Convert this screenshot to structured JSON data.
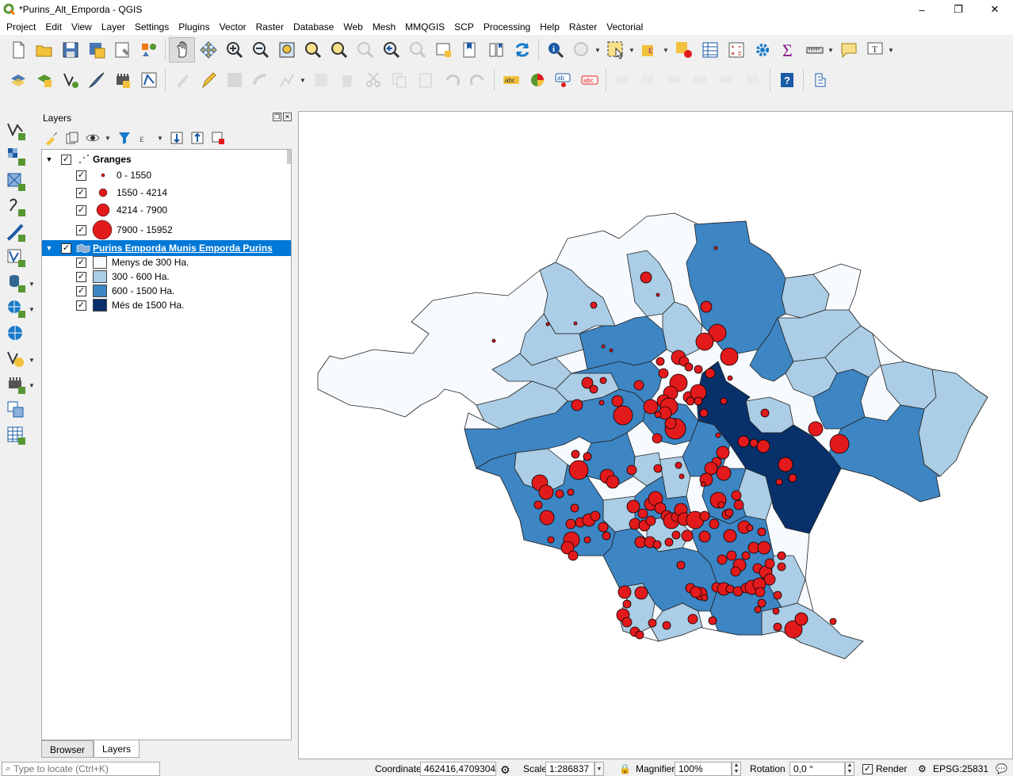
{
  "window": {
    "title": "*Purins_Alt_Emporda - QGIS",
    "minimize": "–",
    "restore": "❐",
    "close": "✕"
  },
  "menu": [
    "Project",
    "Edit",
    "View",
    "Layer",
    "Settings",
    "Plugins",
    "Vector",
    "Raster",
    "Database",
    "Web",
    "Mesh",
    "MMQGIS",
    "SCP",
    "Processing",
    "Help",
    "Ràster",
    "Vectorial"
  ],
  "toolbar1": [
    "new-project-icon",
    "open-project-icon",
    "save-project-icon",
    "save-as-icon",
    "print-layout-icon",
    "style-manager-icon",
    "pan-icon",
    "pan-to-selection-icon",
    "zoom-in-icon",
    "zoom-out-icon",
    "zoom-full-icon",
    "zoom-to-selection-icon",
    "zoom-to-layer-icon",
    "zoom-native-icon",
    "zoom-last-icon",
    "zoom-next-icon",
    "new-map-view-icon",
    "new-bookmark-icon",
    "show-bookmarks-icon",
    "refresh-icon",
    "identify-icon",
    "run-action-icon",
    "select-features-icon",
    "select-by-expression-icon",
    "deselect-icon",
    "attribute-table-icon",
    "field-calculator-icon",
    "toolbox-icon",
    "statistics-icon",
    "measure-icon",
    "map-tips-icon",
    "text-annotation-icon"
  ],
  "toolbar2": [
    "layer-style-icon",
    "data-source-icon",
    "digitize-icon",
    "digitize-pen-icon",
    "gps-icon",
    "vertex-tool-icon",
    "current-edits-icon",
    "toggle-editing-icon",
    "save-edits-icon",
    "add-feature-icon",
    "move-feature-icon",
    "node-tool-icon",
    "delete-selected-icon",
    "cut-icon",
    "copy-icon",
    "paste-icon",
    "undo-icon",
    "redo-icon",
    "label-icon",
    "diagram-icon",
    "pin-label-icon",
    "show-hide-label-icon",
    "move-label-icon",
    "rotate-label-icon",
    "change-label-icon",
    "label-tool-1-icon",
    "label-tool-2-icon",
    "label-tool-3-icon",
    "help-icon",
    "plugin-icon"
  ],
  "layers_panel": {
    "title": "Layers",
    "groups": [
      {
        "name": "Granges",
        "checked": true,
        "expanded": true,
        "classes": [
          {
            "label": "0 - 1550",
            "symbol": "dot-small"
          },
          {
            "label": "1550 - 4214",
            "symbol": "dot-medium"
          },
          {
            "label": "4214 - 7900",
            "symbol": "dot-large"
          },
          {
            "label": "7900 - 15952",
            "symbol": "dot-xlarge"
          }
        ]
      },
      {
        "name": "Purins Emporda Munis Emporda Purins",
        "checked": true,
        "expanded": true,
        "selected": true,
        "classes": [
          {
            "label": "Menys de 300 Ha.",
            "color": "#f7fbff"
          },
          {
            "label": "300 - 600  Ha.",
            "color": "#abcde5"
          },
          {
            "label": "600 - 1500 Ha.",
            "color": "#3d85c3"
          },
          {
            "label": "Més de 1500 Ha.",
            "color": "#08306b"
          }
        ]
      }
    ],
    "tabs": [
      "Browser",
      "Layers"
    ],
    "active_tab": "Layers"
  },
  "status": {
    "locator_placeholder": "Type to locate (Ctrl+K)",
    "coordinate_label": "Coordinate",
    "coordinate_value": "462416,4709304",
    "scale_label": "Scale",
    "scale_value": "1:286837",
    "magnifier_label": "Magnifier",
    "magnifier_value": "100%",
    "rotation_label": "Rotation",
    "rotation_value": "0,0 °",
    "render_label": "Render",
    "render_checked": true,
    "crs": "EPSG:25831"
  },
  "colors": {
    "class1": "#f7fbff",
    "class2": "#abcde5",
    "class3": "#3d85c3",
    "class4": "#08306b",
    "point": "#e31a1c",
    "selection": "#0078d7"
  }
}
